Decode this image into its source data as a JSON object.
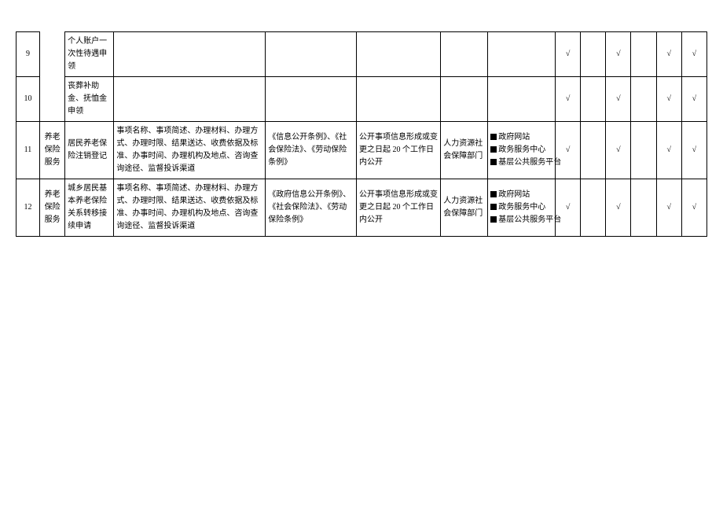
{
  "check": "√",
  "rows": [
    {
      "num": "9",
      "item": "个人账户一次性待遇申领",
      "cont": "",
      "basis": "",
      "timing": "",
      "subject": "",
      "channels": [],
      "c1": "√",
      "c2": "",
      "c3": "√",
      "c4": "",
      "c5": "√",
      "c6": "√"
    },
    {
      "num": "10",
      "item": "丧葬补助金、抚恤金申领",
      "cont": "",
      "basis": "",
      "timing": "",
      "subject": "",
      "channels": [],
      "c1": "√",
      "c2": "",
      "c3": "√",
      "c4": "",
      "c5": "√",
      "c6": "√"
    },
    {
      "num": "11",
      "cat": "养老保险服务",
      "item": "居民养老保险注销登记",
      "cont": "事项名称、事项简述、办理材料、办理方式、办理时限、结果送达、收费依据及标准、办事时间、办理机构及地点、咨询查询途径、监督投诉渠道",
      "basis": "《信息公开条例》、《社会保险法》、《劳动保险条例》",
      "timing": "公开事项信息形成或变更之日起 20 个工作日内公开",
      "subject": "人力资源社会保障部门",
      "channels": [
        "政府网站",
        "政务服务中心",
        "基层公共服务平台"
      ],
      "c1": "√",
      "c2": "",
      "c3": "√",
      "c4": "",
      "c5": "√",
      "c6": "√"
    },
    {
      "num": "12",
      "cat": "养老保险服务",
      "item": "城乡居民基本养老保险关系转移接续申请",
      "cont": "事项名称、事项简述、办理材料、办理方式、办理时限、结果送达、收费依据及标准、办事时间、办理机构及地点、咨询查询途径、监督投诉渠道",
      "basis": "《政府信息公开条例》、《社会保险法》、《劳动保险条例》",
      "timing": "公开事项信息形成或变更之日起 20 个工作日内公开",
      "subject": "人力资源社会保障部门",
      "channels": [
        "政府网站",
        "政务服务中心",
        "基层公共服务平台"
      ],
      "c1": "√",
      "c2": "",
      "c3": "√",
      "c4": "",
      "c5": "√",
      "c6": "√"
    }
  ]
}
